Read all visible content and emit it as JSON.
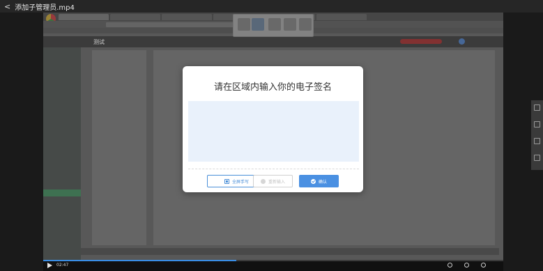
{
  "player": {
    "back_glyph": "<",
    "file_title": "添加子管理员.mp4",
    "time_current": "02:47",
    "progress_fraction": 0.42,
    "right_rail_icons": [
      "list-icon",
      "note-icon",
      "help-icon",
      "message-icon"
    ]
  },
  "browser": {
    "tabs": [
      "",
      "",
      "",
      "",
      "",
      ""
    ],
    "url": "",
    "bookmarks": ""
  },
  "app": {
    "title": "测试",
    "footer": ""
  },
  "modal": {
    "title": "请在区域内输入你的电子签名",
    "buttons": {
      "fullscreen_label": "全屏手写",
      "reset_label": "重新输入",
      "confirm_label": "确认"
    }
  },
  "colors": {
    "primary_blue": "#4a90e2",
    "sign_area_bg": "#e9f1fb",
    "sidebar_active": "#3f8a5b"
  }
}
